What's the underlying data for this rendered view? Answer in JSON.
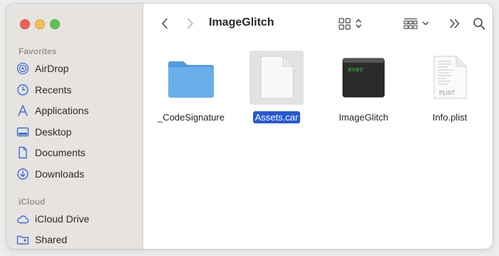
{
  "window": {
    "title": "ImageGlitch"
  },
  "sidebar": {
    "favorites_label": "Favorites",
    "favorites": [
      {
        "label": "AirDrop",
        "icon": "airdrop-icon"
      },
      {
        "label": "Recents",
        "icon": "clock-icon"
      },
      {
        "label": "Applications",
        "icon": "applications-icon"
      },
      {
        "label": "Desktop",
        "icon": "desktop-icon"
      },
      {
        "label": "Documents",
        "icon": "document-icon"
      },
      {
        "label": "Downloads",
        "icon": "download-icon"
      }
    ],
    "icloud_label": "iCloud",
    "icloud": [
      {
        "label": "iCloud Drive",
        "icon": "cloud-icon"
      },
      {
        "label": "Shared",
        "icon": "shared-folder-icon"
      }
    ]
  },
  "files": [
    {
      "name": "_CodeSignature",
      "kind": "folder",
      "selected": false
    },
    {
      "name": "Assets.car",
      "kind": "document",
      "selected": true
    },
    {
      "name": "ImageGlitch",
      "kind": "exec",
      "badge": "exec",
      "selected": false
    },
    {
      "name": "Info.plist",
      "kind": "plist",
      "badge": "PLIST",
      "selected": false
    }
  ],
  "colors": {
    "accent": "#2558d6",
    "sidebar_icon": "#3b6fd4",
    "folder": "#6aaee9"
  }
}
